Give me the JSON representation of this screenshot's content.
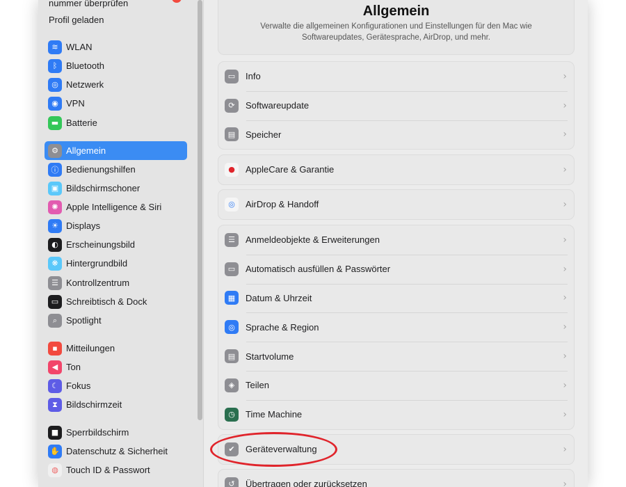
{
  "sidebar": {
    "partial_text": "nummer überprüfen",
    "profile_text": "Profil geladen",
    "items": [
      {
        "label": "WLAN",
        "icon": "wifi-icon",
        "color": "#2f7bf5",
        "glyph": "≋"
      },
      {
        "label": "Bluetooth",
        "icon": "bluetooth-icon",
        "color": "#2f7bf5",
        "glyph": "ᛒ"
      },
      {
        "label": "Netzwerk",
        "icon": "globe-icon",
        "color": "#2f7bf5",
        "glyph": "◎"
      },
      {
        "label": "VPN",
        "icon": "vpn-icon",
        "color": "#2f7bf5",
        "glyph": "◉"
      },
      {
        "label": "Batterie",
        "icon": "battery-icon",
        "color": "#34c759",
        "glyph": "▬"
      },
      {
        "label": "Allgemein",
        "icon": "gear-icon",
        "color": "#8e8e93",
        "glyph": "⚙"
      },
      {
        "label": "Bedienungshilfen",
        "icon": "accessibility-icon",
        "color": "#2f7bf5",
        "glyph": "ⓘ"
      },
      {
        "label": "Bildschirmschoner",
        "icon": "screensaver-icon",
        "color": "#5ac8fa",
        "glyph": "▣"
      },
      {
        "label": "Apple Intelligence & Siri",
        "icon": "siri-icon",
        "color": "#e25bb0",
        "glyph": "✺"
      },
      {
        "label": "Displays",
        "icon": "sun-icon",
        "color": "#2f7bf5",
        "glyph": "☀"
      },
      {
        "label": "Erscheinungsbild",
        "icon": "appearance-icon",
        "color": "#1c1c1e",
        "glyph": "◐"
      },
      {
        "label": "Hintergrundbild",
        "icon": "wallpaper-icon",
        "color": "#5ac8fa",
        "glyph": "❋"
      },
      {
        "label": "Kontrollzentrum",
        "icon": "control-center-icon",
        "color": "#8e8e93",
        "glyph": "☰"
      },
      {
        "label": "Schreibtisch & Dock",
        "icon": "dock-icon",
        "color": "#1c1c1e",
        "glyph": "▭"
      },
      {
        "label": "Spotlight",
        "icon": "search-icon",
        "color": "#8e8e93",
        "glyph": "⌕"
      },
      {
        "label": "Mitteilungen",
        "icon": "notifications-icon",
        "color": "#f24a3f",
        "glyph": "▪"
      },
      {
        "label": "Ton",
        "icon": "sound-icon",
        "color": "#f2456a",
        "glyph": "◀"
      },
      {
        "label": "Fokus",
        "icon": "moon-icon",
        "color": "#5e5ce6",
        "glyph": "☾"
      },
      {
        "label": "Bildschirmzeit",
        "icon": "hourglass-icon",
        "color": "#5e5ce6",
        "glyph": "⧗"
      },
      {
        "label": "Sperrbildschirm",
        "icon": "lock-screen-icon",
        "color": "#1c1c1e",
        "glyph": "■"
      },
      {
        "label": "Datenschutz & Sicherheit",
        "icon": "hand-icon",
        "color": "#2f7bf5",
        "glyph": "✋"
      },
      {
        "label": "Touch ID & Passwort",
        "icon": "fingerprint-icon",
        "color": "#f0f0f0",
        "glyph": "◍"
      }
    ]
  },
  "header": {
    "title": "Allgemein",
    "description": "Verwalte die allgemeinen Konfigurationen und Einstellungen für den Mac wie Softwareupdates, Gerätesprache, AirDrop, und mehr."
  },
  "groups": [
    {
      "rows": [
        {
          "label": "Info",
          "icon": "info-laptop-icon",
          "color": "#8e8e93",
          "glyph": "▭"
        },
        {
          "label": "Softwareupdate",
          "icon": "software-update-icon",
          "color": "#8e8e93",
          "glyph": "⟳"
        },
        {
          "label": "Speicher",
          "icon": "storage-icon",
          "color": "#8e8e93",
          "glyph": "▤"
        }
      ]
    },
    {
      "rows": [
        {
          "label": "AppleCare & Garantie",
          "icon": "apple-icon",
          "color": "#f5f5f5",
          "glyph": "●"
        }
      ]
    },
    {
      "rows": [
        {
          "label": "AirDrop & Handoff",
          "icon": "airdrop-icon",
          "color": "#f5f5f5",
          "glyph": "◎"
        }
      ]
    },
    {
      "rows": [
        {
          "label": "Anmeldeobjekte & Erweiterungen",
          "icon": "login-items-icon",
          "color": "#8e8e93",
          "glyph": "☰"
        },
        {
          "label": "Automatisch ausfüllen & Passwörter",
          "icon": "autofill-icon",
          "color": "#8e8e93",
          "glyph": "▭"
        },
        {
          "label": "Datum & Uhrzeit",
          "icon": "calendar-icon",
          "color": "#2f7bf5",
          "glyph": "▦"
        },
        {
          "label": "Sprache & Region",
          "icon": "globe-icon",
          "color": "#2f7bf5",
          "glyph": "◎"
        },
        {
          "label": "Startvolume",
          "icon": "disk-icon",
          "color": "#8e8e93",
          "glyph": "▤"
        },
        {
          "label": "Teilen",
          "icon": "sharing-icon",
          "color": "#8e8e93",
          "glyph": "◈"
        },
        {
          "label": "Time Machine",
          "icon": "time-machine-icon",
          "color": "#2a6f4f",
          "glyph": "◷"
        }
      ]
    },
    {
      "rows": [
        {
          "label": "Geräteverwaltung",
          "icon": "device-management-icon",
          "color": "#8e8e93",
          "glyph": "✔"
        }
      ]
    },
    {
      "rows": [
        {
          "label": "Übertragen oder zurücksetzen",
          "icon": "reset-icon",
          "color": "#8e8e93",
          "glyph": "↺"
        }
      ]
    }
  ],
  "chevron_glyph": "›",
  "highlight_color": "#e0242b"
}
